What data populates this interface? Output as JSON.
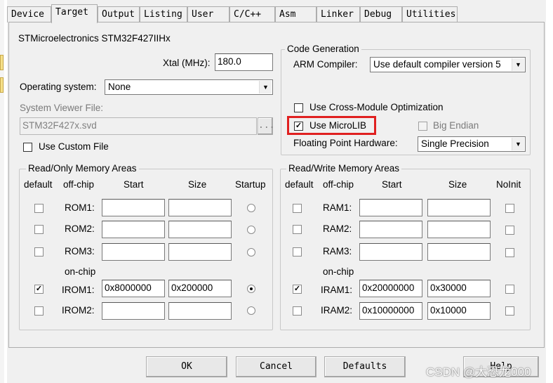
{
  "tabs": [
    "Device",
    "Target",
    "Output",
    "Listing",
    "User",
    "C/C++",
    "Asm",
    "Linker",
    "Debug",
    "Utilities"
  ],
  "active_tab": "Target",
  "device_name": "STMicroelectronics STM32F427IIHx",
  "xtal": {
    "label": "Xtal (MHz):",
    "value": "180.0"
  },
  "os": {
    "label": "Operating system:",
    "value": "None"
  },
  "svd": {
    "label": "System Viewer File:",
    "value": "STM32F427x.svd",
    "browse": "..."
  },
  "custom_file": {
    "label": "Use Custom File",
    "checked": false
  },
  "codegen": {
    "title": "Code Generation",
    "compiler_label": "ARM Compiler:",
    "compiler_value": "Use default compiler version 5",
    "cross_module": {
      "label": "Use Cross-Module Optimization",
      "checked": false
    },
    "microlib": {
      "label": "Use MicroLIB",
      "checked": true
    },
    "big_endian": {
      "label": "Big Endian",
      "checked": false
    },
    "fp_label": "Floating Point Hardware:",
    "fp_value": "Single Precision"
  },
  "rom": {
    "title": "Read/Only Memory Areas",
    "headers": {
      "default": "default",
      "offchip": "off-chip",
      "start": "Start",
      "size": "Size",
      "startup": "Startup"
    },
    "onchip_label": "on-chip",
    "rows": [
      {
        "label": "ROM1:",
        "start": "",
        "size": "",
        "default": false,
        "startup": false
      },
      {
        "label": "ROM2:",
        "start": "",
        "size": "",
        "default": false,
        "startup": false
      },
      {
        "label": "ROM3:",
        "start": "",
        "size": "",
        "default": false,
        "startup": false
      },
      {
        "label": "IROM1:",
        "start": "0x8000000",
        "size": "0x200000",
        "default": true,
        "startup": true
      },
      {
        "label": "IROM2:",
        "start": "",
        "size": "",
        "default": false,
        "startup": false
      }
    ]
  },
  "ram": {
    "title": "Read/Write Memory Areas",
    "headers": {
      "default": "default",
      "offchip": "off-chip",
      "start": "Start",
      "size": "Size",
      "noinit": "NoInit"
    },
    "onchip_label": "on-chip",
    "rows": [
      {
        "label": "RAM1:",
        "start": "",
        "size": "",
        "default": false,
        "noinit": false
      },
      {
        "label": "RAM2:",
        "start": "",
        "size": "",
        "default": false,
        "noinit": false
      },
      {
        "label": "RAM3:",
        "start": "",
        "size": "",
        "default": false,
        "noinit": false
      },
      {
        "label": "IRAM1:",
        "start": "0x20000000",
        "size": "0x30000",
        "default": true,
        "noinit": false
      },
      {
        "label": "IRAM2:",
        "start": "0x10000000",
        "size": "0x10000",
        "default": false,
        "noinit": false
      }
    ]
  },
  "buttons": {
    "ok": "OK",
    "cancel": "Cancel",
    "defaults": "Defaults",
    "help": "Help"
  },
  "watermark": "CSDN @大恐龙000",
  "colors": {
    "highlight": "#e02020",
    "panel": "#f0f0f0"
  }
}
